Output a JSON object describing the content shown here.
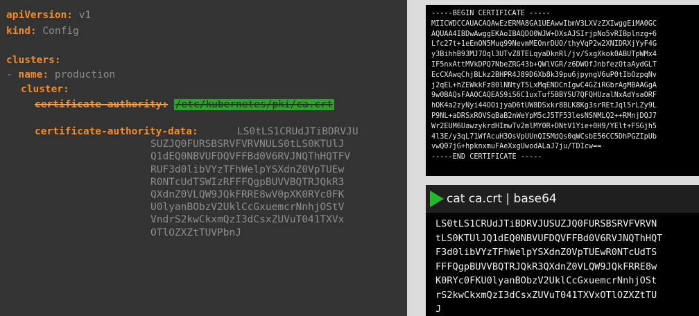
{
  "yaml": {
    "api_version_key": "apiVersion:",
    "api_version_value": " v1",
    "kind_key": "kind:",
    "kind_value": " Config",
    "clusters_key": "clusters:",
    "dash": "- ",
    "name_key": "name:",
    "name_value": " production",
    "cluster_key": "cluster:",
    "ca_key": "certificate-authority:",
    "ca_value": "/etc/kubernetes/pki/ca.crt",
    "ca_data_key": "certificate-authority-data:",
    "ca_data_lines": [
      "LS0tLS1CRUdJTiBDRVJU",
      "SUZJQ0FURSBSRVFVRVNULS0tLS0KTUlJ",
      "Q1dEQ0NBVUFDQVFFBd0V6RVJNQThHQTFV",
      "RUF3d0libVYzTFhWelpYSXdnZ0VpTUEw",
      "R0NTcUdTSWIzRFFFQgpBUVVBQTRJQkR3",
      "QXdnZ0VLQW9JQkFRRE8wV0pXK0RYc0FK",
      "U0lyanBObzV2UklCcGxuemcrNnhjOStV",
      "VndrS2kwCkxmQzI3dCsxZUVuT041TXVx",
      "OTlOZXZtTUVPbnJ"
    ]
  },
  "certificate": {
    "lines": [
      "-----BEGIN CERTIFICATE -----",
      "MIICWDCCAUACAQAwEzERMA8GA1UEAwwIbmV3LXVzZXIwggEiMA0GC",
      "AQUAA4IBDwAwggEKAoIBAQDO0WJW+DXsAJSIrjpNo5vRIBplnzg+6",
      "Lfc27t+1eEnON5Muq99NevmMEOnrDUO/thyVqP2w2XNIDRXjYyF4G",
      "y3BihhB93MJ7Oql3UTvZ8TELqyaDknRl/jv/SxgXkok0ABUTpWMx4",
      "IF5nxAttMVkDPQ7NbeZRG43b+QWlVGR/z6DWOfJnbfezOtaAydGLT",
      "EcCXAwqChjBLkz2BHPR4J89D6Xb8k39pu6jpyngV6uP0tIbOzpqNv",
      "j2qEL+hZEWkkFz80lNNtyT5LxMqENDCnIgwC4GZiRGbrAgMBAAGgA",
      "9w0BAQsFAAOCAQEAS9iS6C1uxTuf5BBYSU7QFQHUzalNxAdYsaORF",
      "hOK4a2zyNyi44OOijyaD6tUW8DSxkr8BLK8Kg3srREtJql5rLZy9L",
      "P9NL+aDRSxROVSqBaB2nWeYpM5cJ5TF53lesNSNMLQ2++RMnjDQJ7",
      "Wr2EUM6UawzykrdHImwTv2mlMY0R+DNtV1Yie+0H9/YElt+FSGjh5",
      "4l3E/y3qL71WfAcuH3OsVpUUnQISMdQs0qWCsbE56CC5DhPGZIpUb",
      "vwQ07jG+hpknxmuFAeXxgUwodALaJ7ju/TDIcw==",
      "-----END CERTIFICATE -----"
    ]
  },
  "terminal": {
    "command": "cat ca.crt | base64",
    "prompt_color": "#25b82a",
    "output_lines": [
      "LS0tLS1CRUdJTiBDRVJUSUZJQ0FURSBSRVFVRVN",
      "tLS0KTUlJQ1dEQ0NBVUFDQVFFBd0V6RVJNQThHQT",
      "F3d0libVYzTFhWelpYSXdnZ0VpTUEwR0NTcUdTS",
      "FFFQgpBUVVBQTRJQkR3QXdnZ0VLQW9JQkFRRE8w",
      "K0RYc0FKU0lyanBObzV2UklCcGxuemcrNnhjOSt",
      "rS2kwCkxmQzI3dCsxZUVuT041TXVxOTlOZXZtTU",
      "J"
    ]
  },
  "colors": {
    "yaml_background": "#333333",
    "yaml_key": "#f08c2c",
    "yaml_value": "#8e8e8e",
    "highlight": "#2ea12e",
    "terminal_background": "#000000"
  }
}
